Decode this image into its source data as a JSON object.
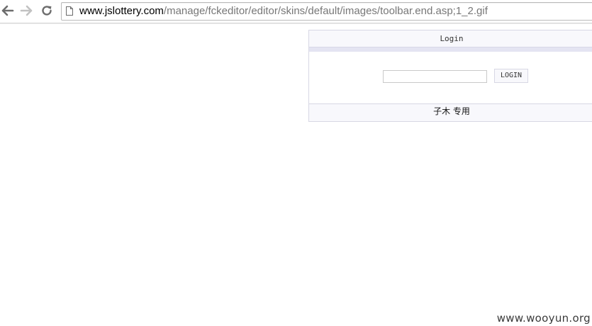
{
  "browser": {
    "url_host": "www.jslottery.com",
    "url_path": "/manage/fckeditor/editor/skins/default/images/toolbar.end.asp;1_2.gif",
    "icons": {
      "back": "arrow-left-icon",
      "forward": "arrow-right-icon",
      "reload": "reload-icon",
      "page": "page-icon"
    }
  },
  "login": {
    "title": "Login",
    "password_value": "",
    "button_label": "LOGIN",
    "footer": "子木 专用"
  },
  "watermark": "www.wooyun.org",
  "colors": {
    "panel_border": "#d8d8e4",
    "panel_bg": "#f8f8fc",
    "stripe": "#e4e4f2"
  }
}
